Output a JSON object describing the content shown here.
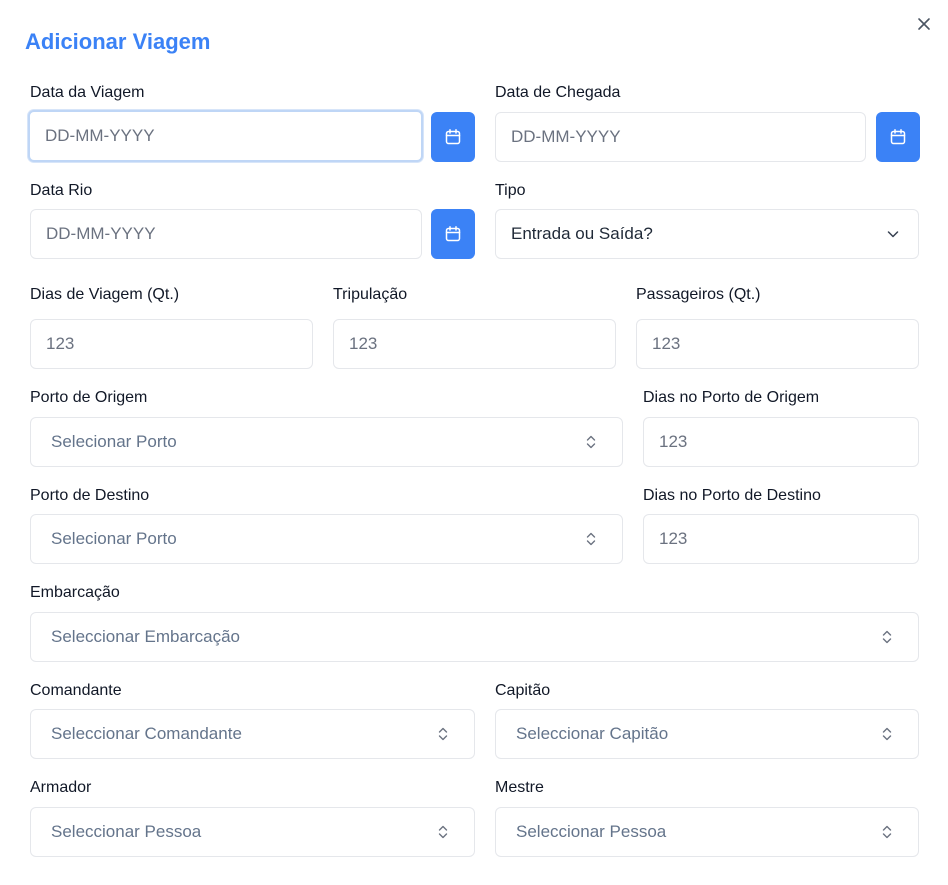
{
  "dialog": {
    "title": "Adicionar Viagem",
    "close_icon": "close-icon"
  },
  "colors": {
    "accent": "#3b82f6",
    "border": "#e5e7eb",
    "placeholder": "#6b7280"
  },
  "fields": {
    "data_viagem": {
      "label": "Data da Viagem",
      "placeholder": "DD-MM-YYYY"
    },
    "data_chegada": {
      "label": "Data de Chegada",
      "placeholder": "DD-MM-YYYY"
    },
    "data_rio": {
      "label": "Data Rio",
      "placeholder": "DD-MM-YYYY"
    },
    "tipo": {
      "label": "Tipo",
      "value": "Entrada ou Saída?"
    },
    "dias_viagem": {
      "label": "Dias de Viagem (Qt.)",
      "placeholder": "123"
    },
    "tripulacao": {
      "label": "Tripulação",
      "placeholder": "123"
    },
    "passageiros": {
      "label": "Passageiros (Qt.)",
      "placeholder": "123"
    },
    "porto_origem": {
      "label": "Porto de Origem",
      "placeholder": "Selecionar Porto"
    },
    "dias_porto_origem": {
      "label": "Dias no Porto de Origem",
      "placeholder": "123"
    },
    "porto_destino": {
      "label": "Porto de Destino",
      "placeholder": "Selecionar Porto"
    },
    "dias_porto_destino": {
      "label": "Dias no Porto de Destino",
      "placeholder": "123"
    },
    "embarcacao": {
      "label": "Embarcação",
      "placeholder": "Seleccionar Embarcação"
    },
    "comandante": {
      "label": "Comandante",
      "placeholder": "Seleccionar Comandante"
    },
    "capitao": {
      "label": "Capitão",
      "placeholder": "Seleccionar Capitão"
    },
    "armador": {
      "label": "Armador",
      "placeholder": "Seleccionar Pessoa"
    },
    "mestre": {
      "label": "Mestre",
      "placeholder": "Seleccionar Pessoa"
    }
  }
}
